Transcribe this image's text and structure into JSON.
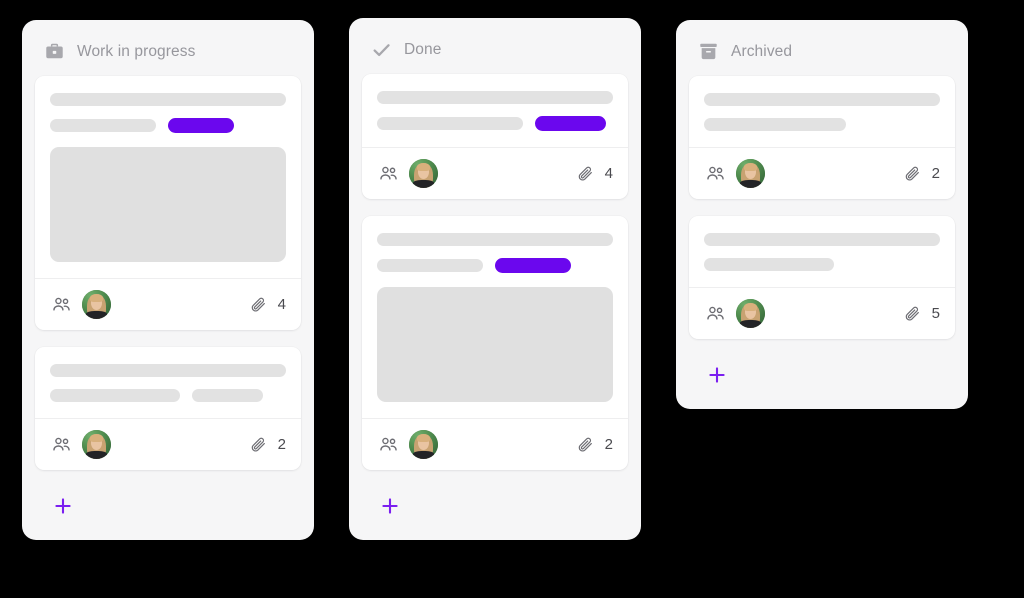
{
  "board": {
    "background_color": "#000000",
    "column_color": "#f6f6f7",
    "card_color": "#ffffff",
    "accent_color": "#6b07ee",
    "placeholder_color": "#e2e2e2",
    "image_placeholder_color": "#e0e0e0",
    "add_button_color": "#7b1ff0",
    "icon_color": "#6d6d73",
    "header_text_color": "#97979d"
  },
  "columns": [
    {
      "id": "work-in-progress",
      "title": "Work in progress",
      "icon": "briefcase-icon",
      "add_label": "+",
      "cards": [
        {
          "id": "wip-card-1",
          "lines": [
            {
              "type": "bar",
              "width": "full"
            }
          ],
          "second_row": {
            "bar_width": "w-45",
            "chip_width": "c-28",
            "has_chip": true
          },
          "has_image": true,
          "members": 1,
          "members_icon": "people-icon",
          "avatar": "avatar-woman-green",
          "attachments_icon": "paperclip-icon",
          "attachments": "4"
        },
        {
          "id": "wip-card-2",
          "lines": [
            {
              "type": "bar",
              "width": "full"
            }
          ],
          "second_row": {
            "bar_width": "w-55",
            "chip_width": "",
            "has_chip": false,
            "bar2_width": "w-30"
          },
          "has_image": false,
          "members": 1,
          "members_icon": "people-icon",
          "avatar": "avatar-woman-green",
          "attachments_icon": "paperclip-icon",
          "attachments": "2"
        }
      ]
    },
    {
      "id": "done",
      "title": "Done",
      "icon": "check-icon",
      "add_label": "+",
      "cards": [
        {
          "id": "done-card-1",
          "lines": [
            {
              "type": "bar",
              "width": "full"
            }
          ],
          "second_row": {
            "bar_width": "w-62",
            "chip_width": "c-30",
            "has_chip": true
          },
          "has_image": false,
          "members": 1,
          "members_icon": "people-icon",
          "avatar": "avatar-woman-green",
          "attachments_icon": "paperclip-icon",
          "attachments": "4"
        },
        {
          "id": "done-card-2",
          "lines": [
            {
              "type": "bar",
              "width": "full"
            }
          ],
          "second_row": {
            "bar_width": "w-45",
            "chip_width": "c-32",
            "has_chip": true
          },
          "has_image": true,
          "members": 1,
          "members_icon": "people-icon",
          "avatar": "avatar-woman-green",
          "attachments_icon": "paperclip-icon",
          "attachments": "2"
        }
      ]
    },
    {
      "id": "archived",
      "title": "Archived",
      "icon": "archive-box-icon",
      "add_label": "+",
      "cards": [
        {
          "id": "arch-card-1",
          "lines": [
            {
              "type": "bar",
              "width": "full"
            }
          ],
          "second_row": {
            "bar_width": "w-60",
            "chip_width": "",
            "has_chip": false
          },
          "has_image": false,
          "members": 1,
          "members_icon": "people-icon",
          "avatar": "avatar-woman-green",
          "attachments_icon": "paperclip-icon",
          "attachments": "2"
        },
        {
          "id": "arch-card-2",
          "lines": [
            {
              "type": "bar",
              "width": "full"
            }
          ],
          "second_row": {
            "bar_width": "w-55",
            "chip_width": "",
            "has_chip": false
          },
          "has_image": false,
          "members": 1,
          "members_icon": "people-icon",
          "avatar": "avatar-woman-green",
          "attachments_icon": "paperclip-icon",
          "attachments": "5"
        }
      ]
    }
  ]
}
